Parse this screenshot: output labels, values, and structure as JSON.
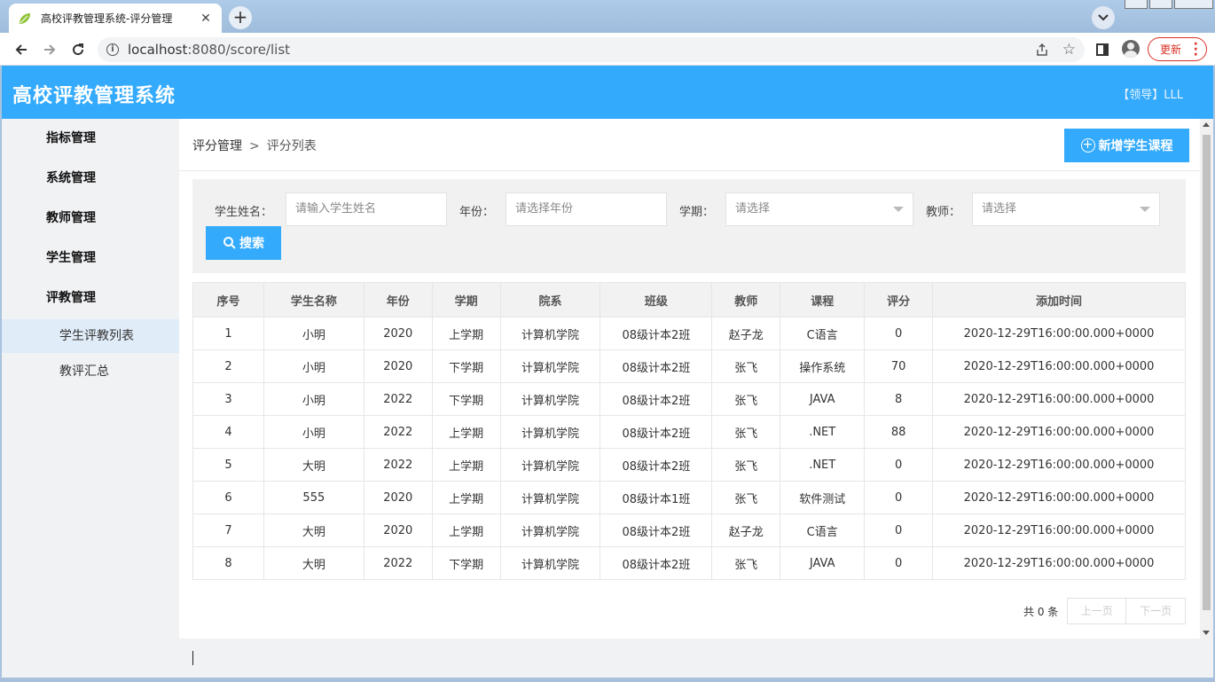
{
  "browser": {
    "tab_title": "高校评教管理系统-评分管理",
    "url_host": "localhost",
    "url_port": ":8080",
    "url_path": "/score/list",
    "update_label": "更新"
  },
  "header": {
    "title": "高校评教管理系统",
    "user": "【领导】LLL"
  },
  "sidebar": {
    "items": [
      {
        "label": "指标管理"
      },
      {
        "label": "系统管理"
      },
      {
        "label": "教师管理"
      },
      {
        "label": "学生管理"
      },
      {
        "label": "评教管理"
      }
    ],
    "sub_items": [
      {
        "label": "学生评教列表",
        "active": true
      },
      {
        "label": "教评汇总",
        "active": false
      }
    ]
  },
  "breadcrumb": {
    "parent": "评分管理",
    "separator": ">",
    "current": "评分列表"
  },
  "toolbar": {
    "add_label": "新增学生课程",
    "search_label": "搜索"
  },
  "filters": {
    "student_label": "学生姓名：",
    "student_placeholder": "请输入学生姓名",
    "year_label": "年份：",
    "year_placeholder": "请选择年份",
    "term_label": "学期：",
    "term_value": "请选择",
    "teacher_label": "教师：",
    "teacher_value": "请选择"
  },
  "table": {
    "columns": [
      "序号",
      "学生名称",
      "年份",
      "学期",
      "院系",
      "班级",
      "教师",
      "课程",
      "评分",
      "添加时间"
    ],
    "rows": [
      [
        "1",
        "小明",
        "2020",
        "上学期",
        "计算机学院",
        "08级计本2班",
        "赵子龙",
        "C语言",
        "0",
        "2020-12-29T16:00:00.000+0000"
      ],
      [
        "2",
        "小明",
        "2020",
        "下学期",
        "计算机学院",
        "08级计本2班",
        "张飞",
        "操作系统",
        "70",
        "2020-12-29T16:00:00.000+0000"
      ],
      [
        "3",
        "小明",
        "2022",
        "下学期",
        "计算机学院",
        "08级计本2班",
        "张飞",
        "JAVA",
        "8",
        "2020-12-29T16:00:00.000+0000"
      ],
      [
        "4",
        "小明",
        "2022",
        "上学期",
        "计算机学院",
        "08级计本2班",
        "张飞",
        ".NET",
        "88",
        "2020-12-29T16:00:00.000+0000"
      ],
      [
        "5",
        "大明",
        "2022",
        "上学期",
        "计算机学院",
        "08级计本2班",
        "张飞",
        ".NET",
        "0",
        "2020-12-29T16:00:00.000+0000"
      ],
      [
        "6",
        "555",
        "2020",
        "上学期",
        "计算机学院",
        "08级计本1班",
        "张飞",
        "软件测试",
        "0",
        "2020-12-29T16:00:00.000+0000"
      ],
      [
        "7",
        "大明",
        "2020",
        "上学期",
        "计算机学院",
        "08级计本2班",
        "赵子龙",
        "C语言",
        "0",
        "2020-12-29T16:00:00.000+0000"
      ],
      [
        "8",
        "大明",
        "2022",
        "下学期",
        "计算机学院",
        "08级计本2班",
        "张飞",
        "JAVA",
        "0",
        "2020-12-29T16:00:00.000+0000"
      ]
    ]
  },
  "pager": {
    "total": "共 0 条",
    "prev": "上一页",
    "next": "下一页"
  },
  "colors": {
    "accent": "#33aafc",
    "update_red": "#d93025"
  }
}
